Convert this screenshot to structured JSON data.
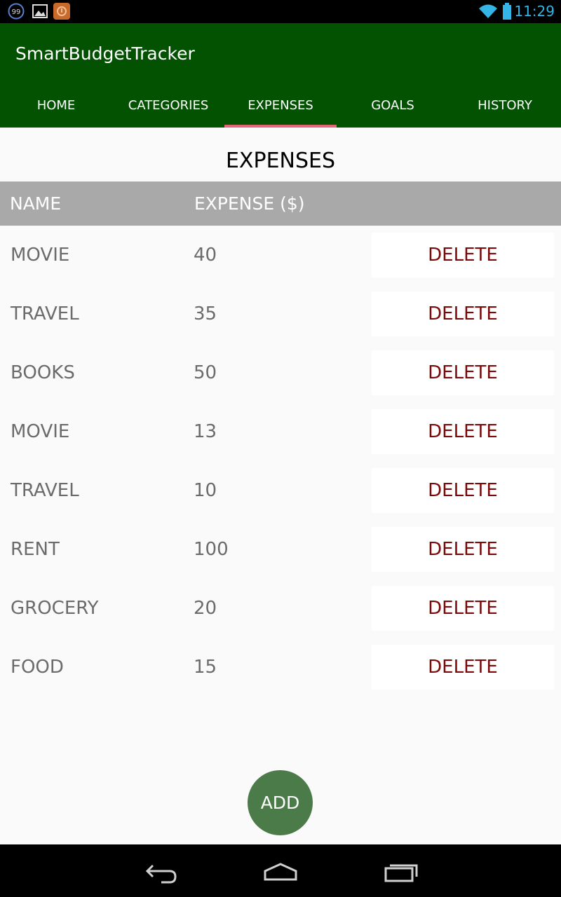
{
  "status_bar": {
    "time": "11:29",
    "notification_badge": "99",
    "icons": [
      "notification-99-icon",
      "image-icon",
      "app-notification-icon",
      "wifi-icon",
      "battery-icon"
    ]
  },
  "app": {
    "title": "SmartBudgetTracker",
    "colors": {
      "primary": "#035202",
      "tab_indicator": "#e46577",
      "header_row": "#a9a9a9",
      "delete_text": "#7a0a0a",
      "fab": "#4a7b49"
    }
  },
  "tabs": [
    {
      "label": "HOME",
      "active": false
    },
    {
      "label": "CATEGORIES",
      "active": false
    },
    {
      "label": "EXPENSES",
      "active": true
    },
    {
      "label": "GOALS",
      "active": false
    },
    {
      "label": "HISTORY",
      "active": false
    }
  ],
  "page": {
    "title": "EXPENSES",
    "columns": {
      "name": "NAME",
      "expense": "EXPENSE ($)"
    },
    "rows": [
      {
        "name": "MOVIE",
        "expense": "40",
        "action": "DELETE"
      },
      {
        "name": "TRAVEL",
        "expense": "35",
        "action": "DELETE"
      },
      {
        "name": "BOOKS",
        "expense": "50",
        "action": "DELETE"
      },
      {
        "name": "MOVIE",
        "expense": "13",
        "action": "DELETE"
      },
      {
        "name": "TRAVEL",
        "expense": "10",
        "action": "DELETE"
      },
      {
        "name": "RENT",
        "expense": "100",
        "action": "DELETE"
      },
      {
        "name": "GROCERY",
        "expense": "20",
        "action": "DELETE"
      },
      {
        "name": "FOOD",
        "expense": "15",
        "action": "DELETE"
      }
    ],
    "add_button": "ADD"
  },
  "nav_bar": {
    "icons": [
      "back-icon",
      "home-icon",
      "recents-icon"
    ]
  }
}
